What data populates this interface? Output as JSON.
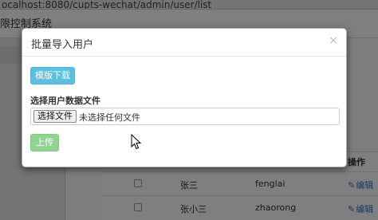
{
  "browser": {
    "url": "ocalhost:8080/cupts-wechat/admin/user/list"
  },
  "app": {
    "header_title": "限控制系统"
  },
  "table": {
    "ops_header": "操作",
    "rows": [
      {
        "name": "张三",
        "username": "fenglai",
        "edit": "编辑"
      },
      {
        "name": "张小三",
        "username": "zhaorong",
        "edit": "编辑"
      }
    ]
  },
  "modal": {
    "title": "批量导入用户",
    "close": "×",
    "template_button": "模版下载",
    "file_label": "选择用户数据文件",
    "choose_file_button": "选择文件",
    "file_status": "未选择任何文件",
    "upload_button": "上传"
  },
  "colors": {
    "info": "#5bc0de",
    "upload": "#8fd58f",
    "link": "#337ab7"
  },
  "icons": {
    "edit": "pencil-icon",
    "close": "close-icon",
    "cursor": "mouse-pointer-icon"
  }
}
